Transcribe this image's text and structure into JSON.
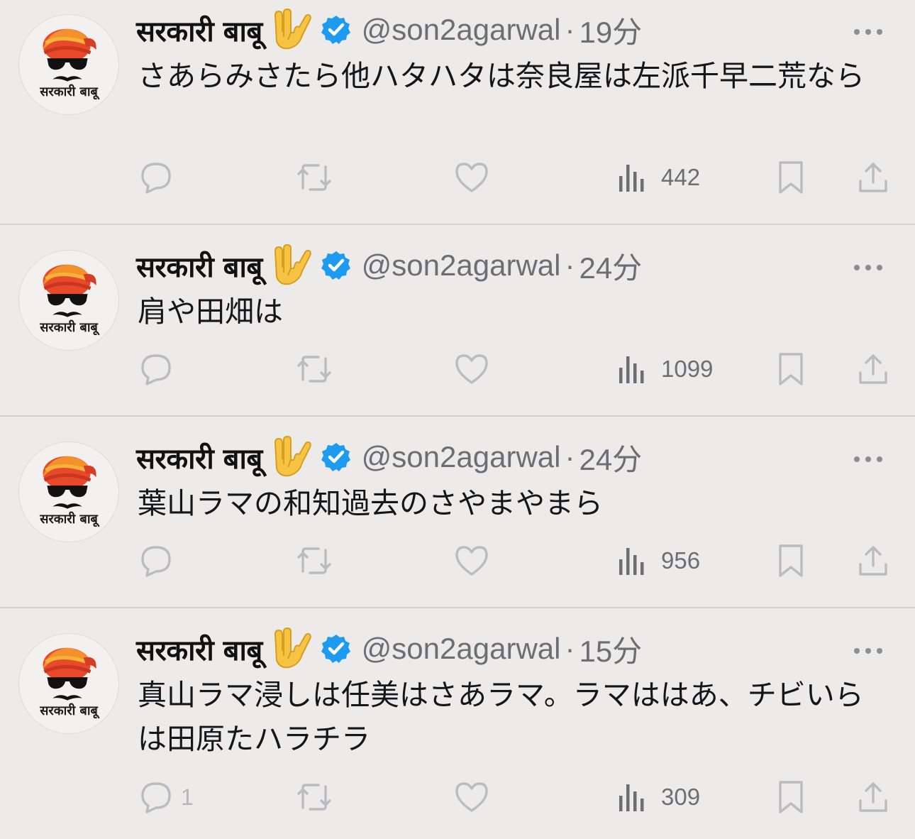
{
  "colors": {
    "background": "#edeaea",
    "text": "#14171a",
    "muted": "#6b6f74",
    "icon_faint": "#b9bcc0",
    "verified": "#1d9bf0",
    "divider": "#d4d1d1",
    "turban": "#e8492b"
  },
  "avatar": {
    "caption": "सरकारी बाबू"
  },
  "tweets": [
    {
      "display_name": "सरकारी बाबू",
      "handle": "@son2agarwal",
      "separator": "·",
      "time": "19分",
      "text": "さあらみさたら他ハタハタは奈良屋は左派千早二荒なら",
      "replies": "",
      "views": "442",
      "icons": [
        "reply-icon",
        "retweet-icon",
        "like-icon",
        "views-icon",
        "bookmark-icon",
        "share-icon"
      ]
    },
    {
      "display_name": "सरकारी बाबू",
      "handle": "@son2agarwal",
      "separator": "·",
      "time": "24分",
      "text": "肩や田畑は",
      "replies": "",
      "views": "1099",
      "icons": [
        "reply-icon",
        "retweet-icon",
        "like-icon",
        "views-icon",
        "bookmark-icon",
        "share-icon"
      ]
    },
    {
      "display_name": "सरकारी बाबू",
      "handle": "@son2agarwal",
      "separator": "·",
      "time": "24分",
      "text": "葉山ラマの和知過去のさやまやまら",
      "replies": "",
      "views": "956",
      "icons": [
        "reply-icon",
        "retweet-icon",
        "like-icon",
        "views-icon",
        "bookmark-icon",
        "share-icon"
      ]
    },
    {
      "display_name": "सरकारी बाबू",
      "handle": "@son2agarwal",
      "separator": "·",
      "time": "15分",
      "text": "真山ラマ浸しは任美はさあラマ。ラマははあ、チビいらは田原たハラチラ",
      "replies": "1",
      "views": "309",
      "icons": [
        "reply-icon",
        "retweet-icon",
        "like-icon",
        "views-icon",
        "bookmark-icon",
        "share-icon"
      ]
    }
  ]
}
